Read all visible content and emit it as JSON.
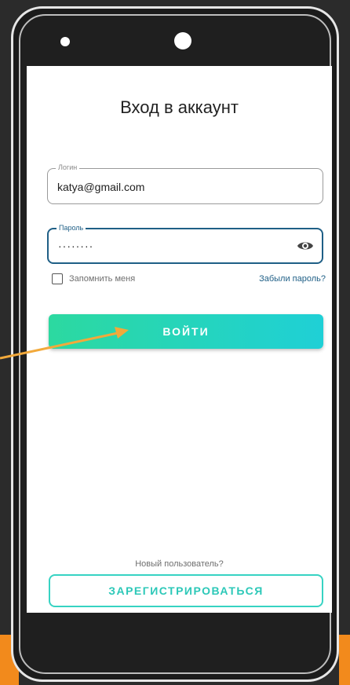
{
  "screen": {
    "title": "Вход в аккаунт",
    "login_field": {
      "label": "Логин",
      "value": "katya@gmail.com"
    },
    "password_field": {
      "label": "Пароль",
      "value": "········",
      "visibility_icon": "eye-icon"
    },
    "remember_me": {
      "label": "Запомнить меня",
      "checked": false
    },
    "forgot_password": "Забыли пароль?",
    "login_button": "ВОЙТИ",
    "new_user_text": "Новый пользователь?",
    "register_button": "ЗАРЕГИСТРИРОВАТЬСЯ"
  },
  "colors": {
    "accent_start": "#2cd9a0",
    "accent_end": "#1fd0d6",
    "link": "#1f5f86",
    "annotation_arrow": "#f2a93b",
    "page_background": "#2b2b2b"
  }
}
